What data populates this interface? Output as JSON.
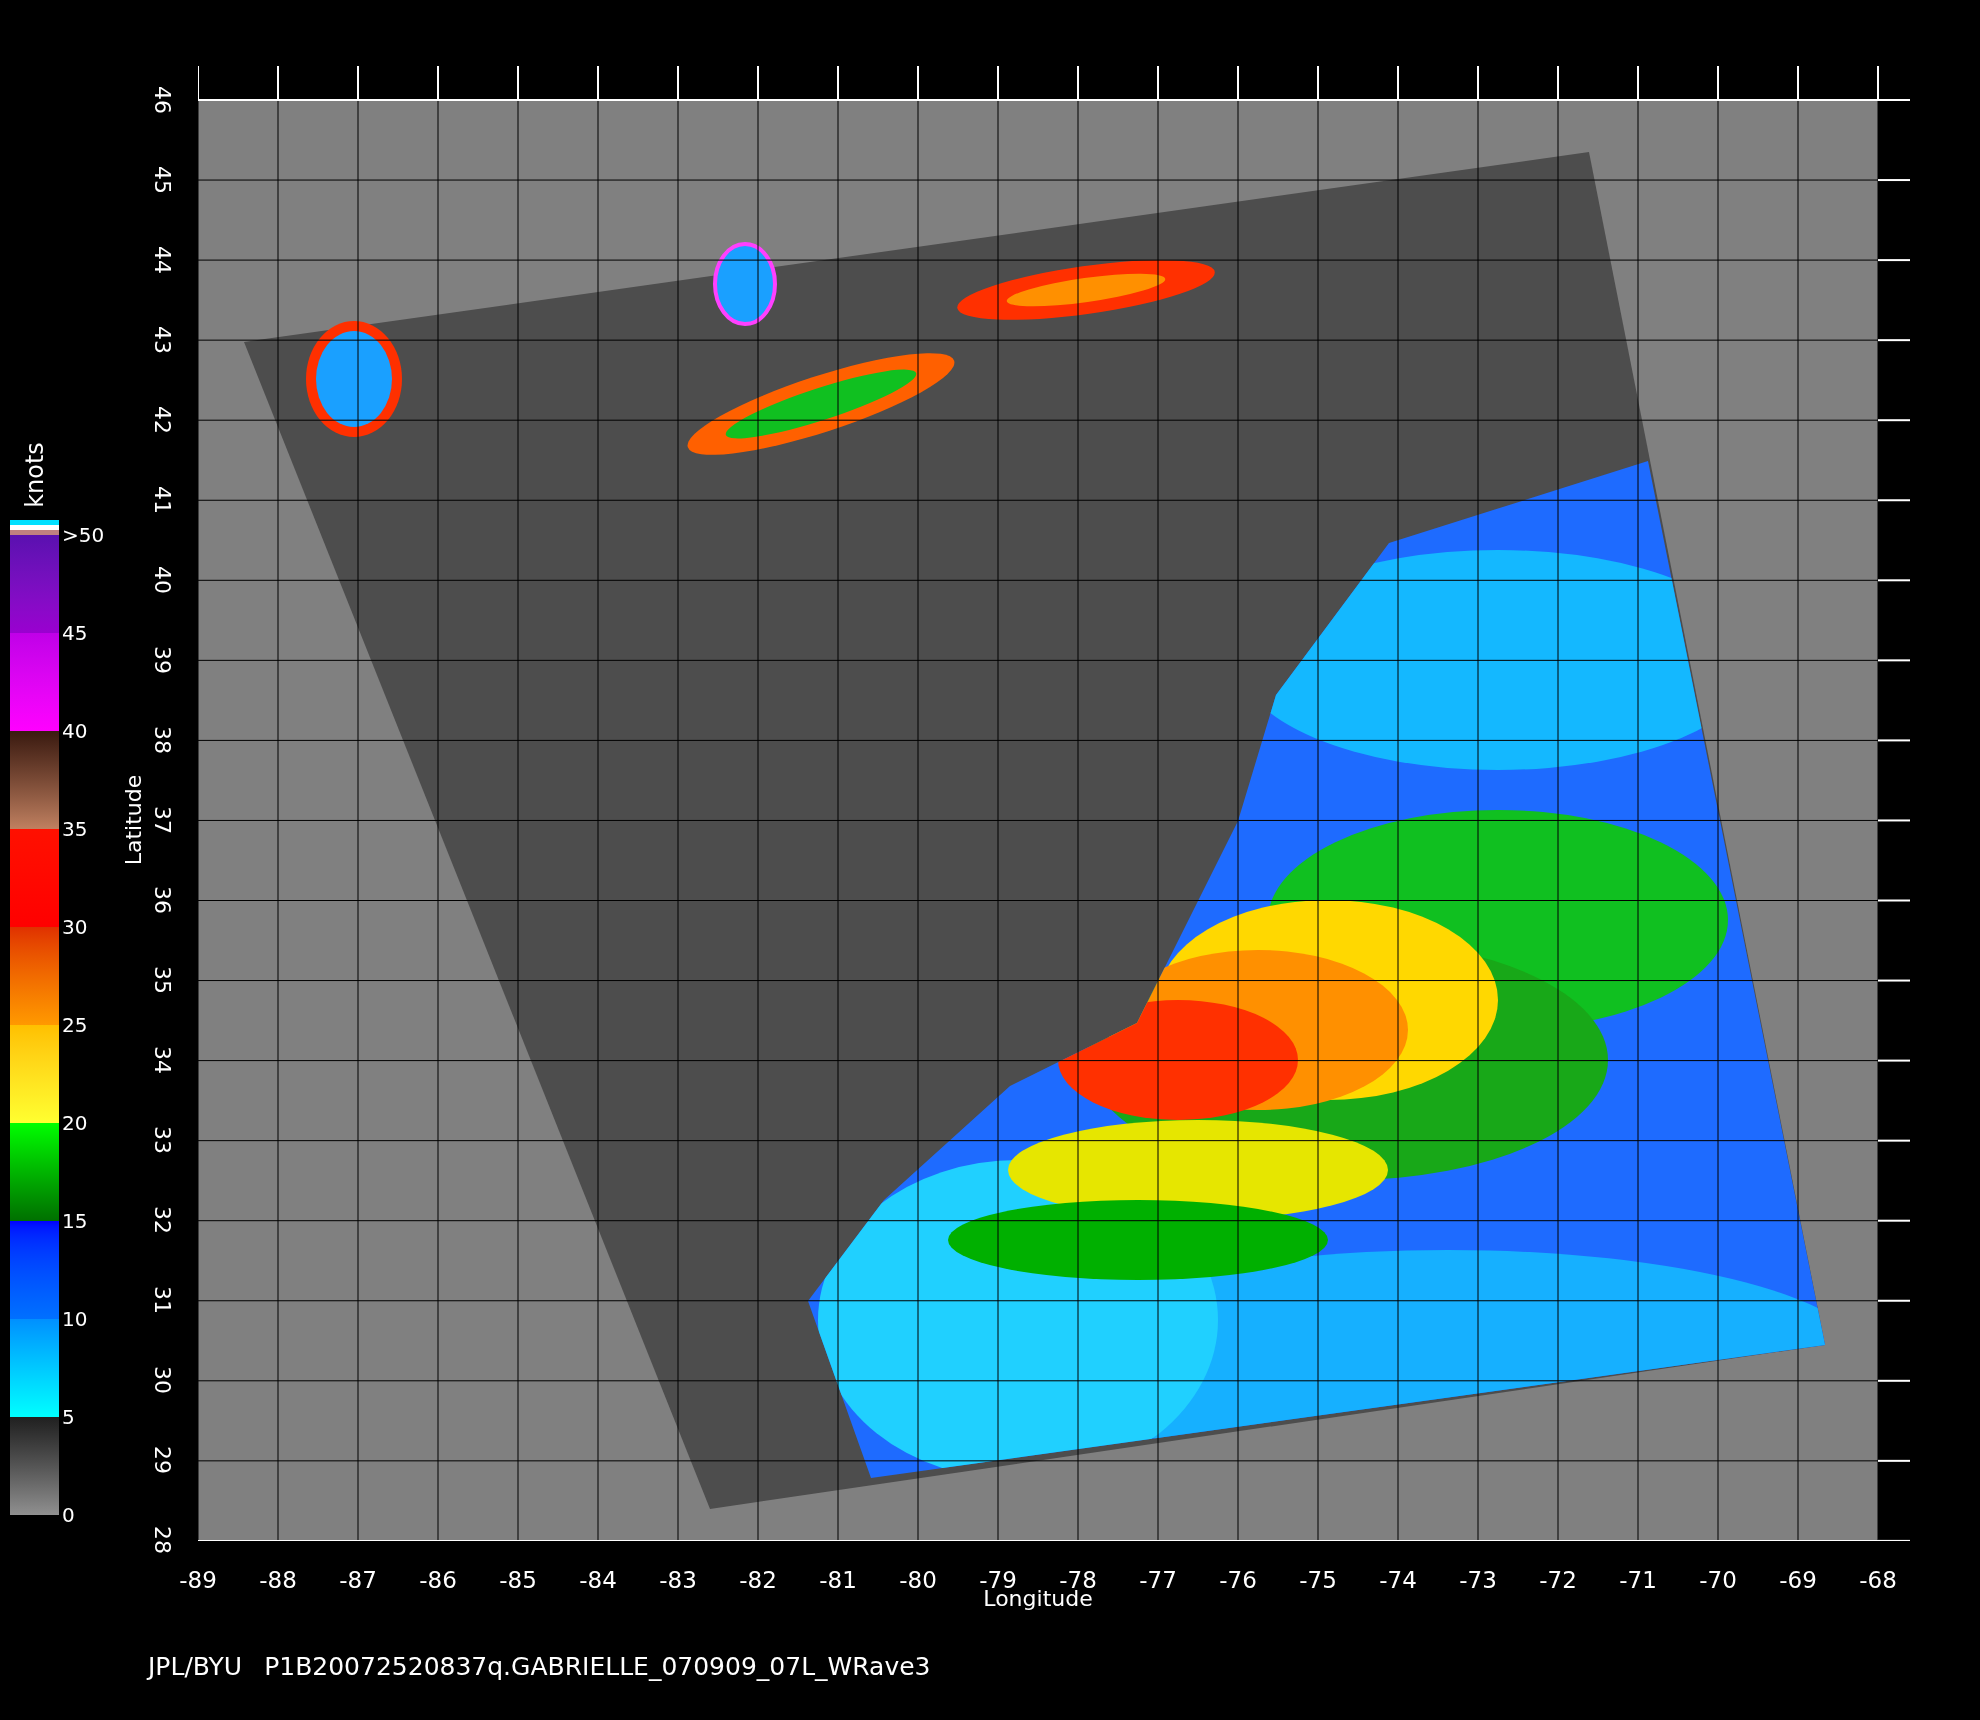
{
  "colorbar": {
    "title": "knots",
    "labels": [
      ">50",
      "45",
      "40",
      "35",
      "30",
      "25",
      "20",
      "15",
      "10",
      "5",
      "0"
    ]
  },
  "plot": {
    "ylabel": "Latitude",
    "xlabel": "Longitude",
    "yticks": [
      "46",
      "45",
      "44",
      "43",
      "42",
      "41",
      "40",
      "39",
      "38",
      "37",
      "36",
      "35",
      "34",
      "33",
      "32",
      "31",
      "30",
      "29",
      "28"
    ],
    "xticks": [
      "-89",
      "-88",
      "-87",
      "-86",
      "-85",
      "-84",
      "-83",
      "-82",
      "-81",
      "-80",
      "-79",
      "-78",
      "-77",
      "-76",
      "-75",
      "-74",
      "-73",
      "-72",
      "-71",
      "-70",
      "-69",
      "-68"
    ]
  },
  "footer": [
    "JPL/BYU",
    "P1B20072520837q.GABRIELLE_070909_07L_WRave3"
  ]
}
